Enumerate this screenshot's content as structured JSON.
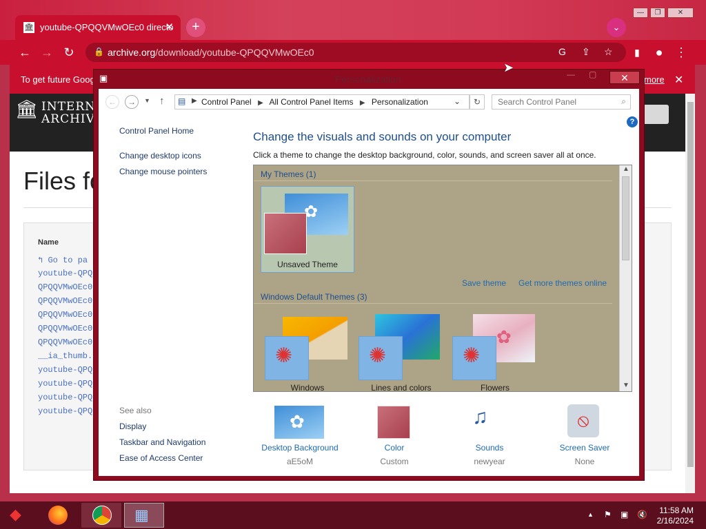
{
  "browser": {
    "tab_title": "youtube-QPQQVMwOEc0 directo",
    "url_host": "archive.org",
    "url_path": "/download/youtube-QPQQVMwOEc0",
    "infobar_text": "To get future Goog",
    "infobar_link": "more"
  },
  "page": {
    "logo_line1": "INTERN",
    "logo_line2": "ARCHIVE",
    "title": "Files fo",
    "column_name": "Name",
    "files": [
      "Go to pa",
      "youtube-QPQ",
      "QPQQVMwOEc0",
      "QPQQVMwOEc0",
      "QPQQVMwOEc0",
      "QPQQVMwOEc0",
      "QPQQVMwOEc0",
      "__ia_thumb.",
      "youtube-QPQ",
      "youtube-QPQ",
      "youtube-QPQ",
      "youtube-QPQ"
    ]
  },
  "cp": {
    "title": "Personalization",
    "breadcrumb": [
      "Control Panel",
      "All Control Panel Items",
      "Personalization"
    ],
    "search_placeholder": "Search Control Panel",
    "sidebar": {
      "home": "Control Panel Home",
      "links": [
        "Change desktop icons",
        "Change mouse pointers"
      ],
      "see_also": "See also",
      "see_also_links": [
        "Display",
        "Taskbar and Navigation",
        "Ease of Access Center"
      ]
    },
    "heading": "Change the visuals and sounds on your computer",
    "subheading": "Click a theme to change the desktop background, color, sounds, and screen saver all at once.",
    "my_themes": "My Themes (1)",
    "unsaved_theme": "Unsaved Theme",
    "save_theme": "Save theme",
    "get_more": "Get more themes online",
    "default_themes": "Windows Default Themes (3)",
    "themes": [
      "Windows",
      "Lines and colors",
      "Flowers"
    ],
    "bottom": [
      {
        "label": "Desktop Background",
        "value": "aE5oM"
      },
      {
        "label": "Color",
        "value": "Custom"
      },
      {
        "label": "Sounds",
        "value": "newyear"
      },
      {
        "label": "Screen Saver",
        "value": "None"
      }
    ]
  },
  "taskbar": {
    "time": "11:58 AM",
    "date": "2/16/2024"
  },
  "colors": {
    "accent": "#c8102e",
    "link": "#1e4e8c"
  }
}
